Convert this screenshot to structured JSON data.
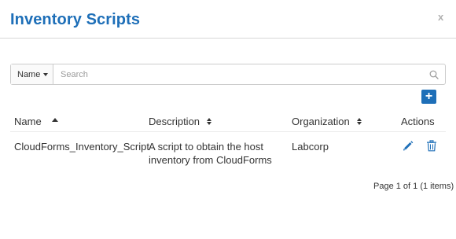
{
  "modal": {
    "title": "Inventory Scripts",
    "close_label": "x"
  },
  "search": {
    "field_select": "Name",
    "placeholder": "Search"
  },
  "table": {
    "columns": [
      {
        "label": "Name",
        "sort": "ascending"
      },
      {
        "label": "Description",
        "sort": "sortable"
      },
      {
        "label": "Organization",
        "sort": "sortable"
      },
      {
        "label": "Actions"
      }
    ],
    "rows": [
      {
        "name": "CloudForms_Inventory_Script",
        "description": "A script to obtain the host inventory from CloudForms",
        "organization": "Labcorp",
        "actions": [
          "pencil-icon",
          "trash-icon"
        ]
      }
    ]
  },
  "pagination": {
    "text": "Page 1 of 1 (1 items)"
  },
  "colors": {
    "accent": "#1e6fb8",
    "border": "#cccccc"
  }
}
